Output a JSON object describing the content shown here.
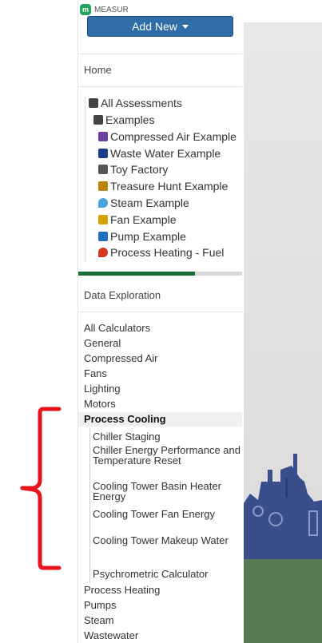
{
  "app": {
    "title": "MEASUR"
  },
  "sidebar": {
    "add_new_label": "Add New",
    "home_label": "Home",
    "tree": [
      {
        "label": "All Assessments",
        "icon": "folder-open-icon",
        "color": "#444"
      },
      {
        "label": "Examples",
        "icon": "folder-open-icon",
        "color": "#444"
      },
      {
        "label": "Compressed Air Example",
        "icon": "compressor-icon",
        "color": "#6b3fa0"
      },
      {
        "label": "Waste Water Example",
        "icon": "tank-icon",
        "color": "#1d3f8a"
      },
      {
        "label": "Toy Factory",
        "icon": "factory-icon",
        "color": "#555"
      },
      {
        "label": "Treasure Hunt Example",
        "icon": "lantern-icon",
        "color": "#b8860b"
      },
      {
        "label": "Steam Example",
        "icon": "water-drop-icon",
        "color": "#4aa3df"
      },
      {
        "label": "Fan Example",
        "icon": "fan-icon",
        "color": "#d4a300"
      },
      {
        "label": "Pump Example",
        "icon": "pump-icon",
        "color": "#1e6fc4"
      },
      {
        "label": "Process Heating - Fuel",
        "icon": "flame-icon",
        "color": "#d9371b"
      }
    ],
    "progress_fraction": 0.71,
    "data_exploration_label": "Data Exploration",
    "categories": [
      "All Calculators",
      "General",
      "Compressed Air",
      "Fans",
      "Lighting",
      "Motors",
      "Process Cooling"
    ],
    "active_category": "Process Cooling",
    "process_cooling_items": [
      "Chiller Staging",
      "Chiller Energy Performance and Temperature Reset",
      "Cooling Tower Basin Heater Energy",
      "Cooling Tower Fan Energy",
      "Cooling Tower Makeup Water",
      "Psychrometric Calculator"
    ],
    "categories_after": [
      "Process Heating",
      "Pumps",
      "Steam",
      "Wastewater"
    ]
  },
  "colors": {
    "brand_green": "#176d37",
    "button_blue": "#2f6ca8",
    "annotation_red": "#e8141b"
  }
}
